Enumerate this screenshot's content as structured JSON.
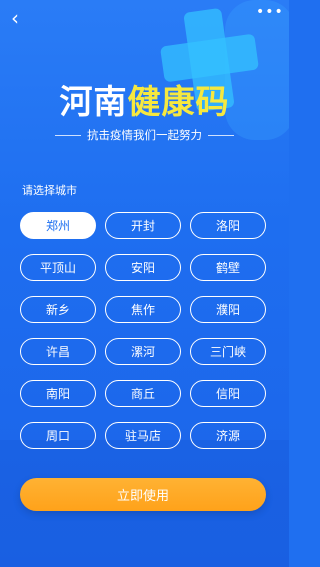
{
  "header": {
    "back_icon": "chevron-left-icon",
    "more_icon": "more-dots-icon",
    "title_part1": "河南",
    "title_part2": "健康码",
    "subtitle": "抗击疫情我们一起努力",
    "title_highlight_color": "#f6e83f"
  },
  "city_selection": {
    "label": "请选择城市",
    "selected": "郑州",
    "cities": [
      {
        "name": "郑州"
      },
      {
        "name": "开封"
      },
      {
        "name": "洛阳"
      },
      {
        "name": "平顶山"
      },
      {
        "name": "安阳"
      },
      {
        "name": "鹤壁"
      },
      {
        "name": "新乡"
      },
      {
        "name": "焦作"
      },
      {
        "name": "濮阳"
      },
      {
        "name": "许昌"
      },
      {
        "name": "漯河"
      },
      {
        "name": "三门峡"
      },
      {
        "name": "南阳"
      },
      {
        "name": "商丘"
      },
      {
        "name": "信阳"
      },
      {
        "name": "周口"
      },
      {
        "name": "驻马店"
      },
      {
        "name": "济源"
      }
    ]
  },
  "cta": {
    "label": "立即使用",
    "color": "#ffa21a"
  },
  "colors": {
    "background": "#1f6ff0",
    "accent_cross": "#34c2ff"
  }
}
